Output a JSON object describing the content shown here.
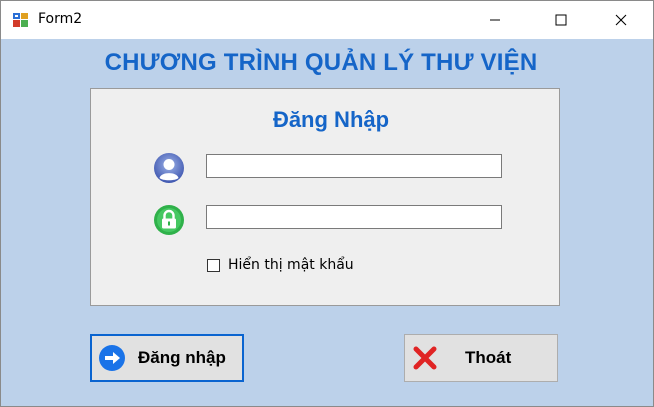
{
  "window": {
    "title": "Form2"
  },
  "header": {
    "app_title": "CHƯƠNG TRÌNH QUẢN LÝ THƯ VIỆN"
  },
  "login_panel": {
    "heading": "Đăng Nhập",
    "username": {
      "value": "",
      "icon": "user-icon"
    },
    "password": {
      "value": "",
      "icon": "lock-icon"
    },
    "show_password": {
      "label": "Hiển thị mật khẩu",
      "checked": false
    }
  },
  "buttons": {
    "login_label": "Đăng nhập",
    "exit_label": "Thoát"
  },
  "colors": {
    "background": "#bcd1ea",
    "accent": "#1565c8",
    "panel": "#efefef"
  }
}
